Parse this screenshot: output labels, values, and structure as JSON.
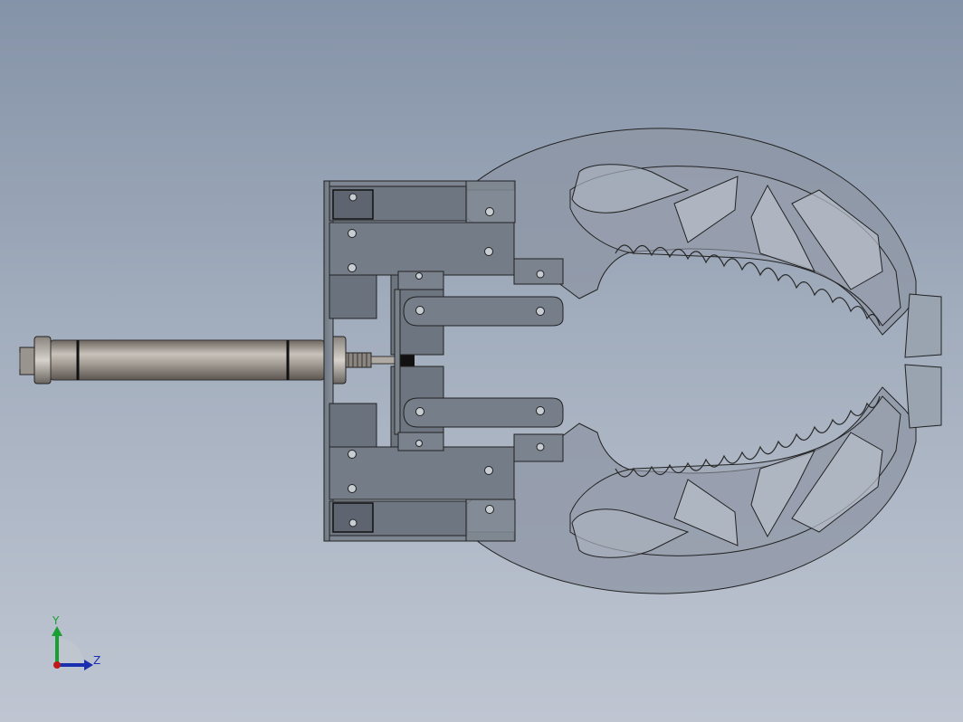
{
  "viewport": {
    "background_top": "#8593a8",
    "background_bottom": "#bfc6d2"
  },
  "model": {
    "parts": [
      "cylinder",
      "front-plate",
      "upper-bracket",
      "lower-bracket",
      "upper-link",
      "lower-link",
      "upper-jaw",
      "lower-jaw"
    ],
    "body_color": "#737b86",
    "edge_color": "#1e1f22",
    "jaw_fill_color": "#8d96a4"
  },
  "triad": {
    "y_label": "Y",
    "z_label": "Z",
    "y_color": "#1aa032",
    "z_color": "#1a2fb0",
    "x_color": "#c01818"
  }
}
